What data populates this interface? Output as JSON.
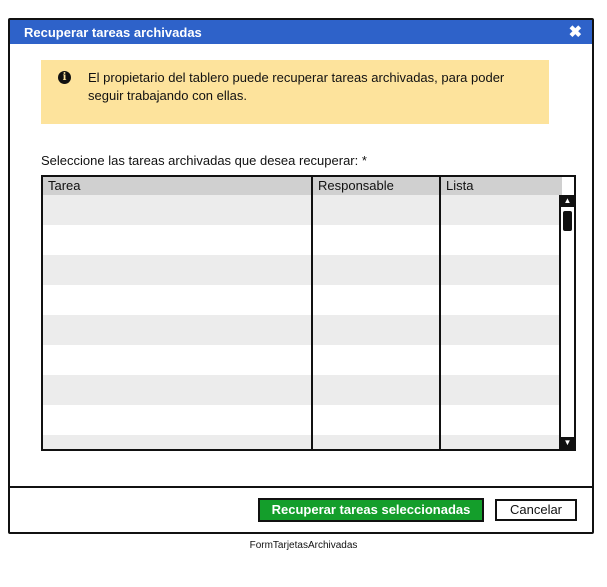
{
  "dialog": {
    "title": "Recuperar tareas archivadas",
    "close_icon": "close-icon"
  },
  "info": {
    "icon": "info-icon",
    "line1": "El propietario del tablero puede recuperar tareas archivadas, para poder",
    "line2": "seguir trabajando con ellas."
  },
  "prompt": "Seleccione las tareas archivadas que desea recuperar: *",
  "table": {
    "columns": [
      "Tarea",
      "Responsable",
      "Lista"
    ],
    "rows": [
      [],
      [],
      [],
      [],
      [],
      [],
      [],
      [],
      []
    ]
  },
  "buttons": {
    "recover": "Recuperar tareas seleccionadas",
    "cancel": "Cancelar"
  },
  "caption": "FormTarjetasArchivadas",
  "colors": {
    "titlebar": "#2e62c9",
    "info_bg": "#fde39c",
    "primary_button": "#149e2b"
  }
}
